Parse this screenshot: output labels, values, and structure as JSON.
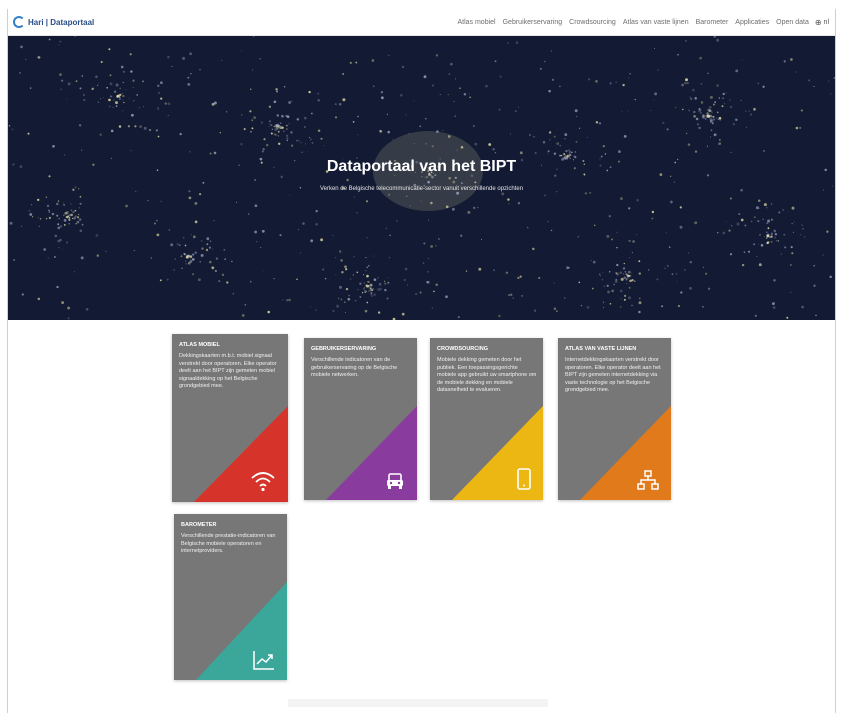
{
  "header": {
    "brand": "Hari | Dataportaal",
    "nav": [
      "Atlas mobiel",
      "Gebruikerservaring",
      "Crowdsourcing",
      "Atlas van vaste lijnen",
      "Barometer",
      "Applicaties",
      "Open data"
    ],
    "lang_icon": "globe-icon",
    "lang": "nl"
  },
  "hero": {
    "title": "Dataportaal van het BIPT",
    "subtitle": "Verken de Belgische telecommunicatie-sector vanuit verschillende opzichten"
  },
  "cards": [
    {
      "title": "Atlas mobiel",
      "desc": "Dekkingskaarten m.b.t. mobiel signaal verstrekt door operatoren. Elke operator deelt aan het BIPT zijn gemeten mobiel signaaldekking op het Belgische grondgebied mee.",
      "icon": "wifi-icon",
      "color": "#d6342b"
    },
    {
      "title": "Gebruikerservaring",
      "desc": "Verschillende indicatoren van de gebruikerservaring op de Belgische mobiele netwerken.",
      "icon": "car-icon",
      "color": "#8a3b9e"
    },
    {
      "title": "Crowdsourcing",
      "desc": "Mobiele dekking gemeten door het publiek. Een toepassingsgerichte mobiele app gebruikt uw smartphone om de mobiele dekking en mobiele datasnelheid te evalueren.",
      "icon": "smartphone-icon",
      "color": "#edb713"
    },
    {
      "title": "Atlas van vaste lijnen",
      "desc": "Internetdekkingskaarten verstrekt door operatoren. Elke operator deelt aan het BIPT zijn gemeten internetdekking via vaste technologie op het Belgische grondgebied mee.",
      "icon": "network-icon",
      "color": "#e07a1b"
    },
    {
      "title": "Barometer",
      "desc": "Verschillende prestatie-indicatoren van Belgische mobiele operatoren en internetproviders.",
      "icon": "chart-icon",
      "color": "#3aa79a"
    }
  ]
}
